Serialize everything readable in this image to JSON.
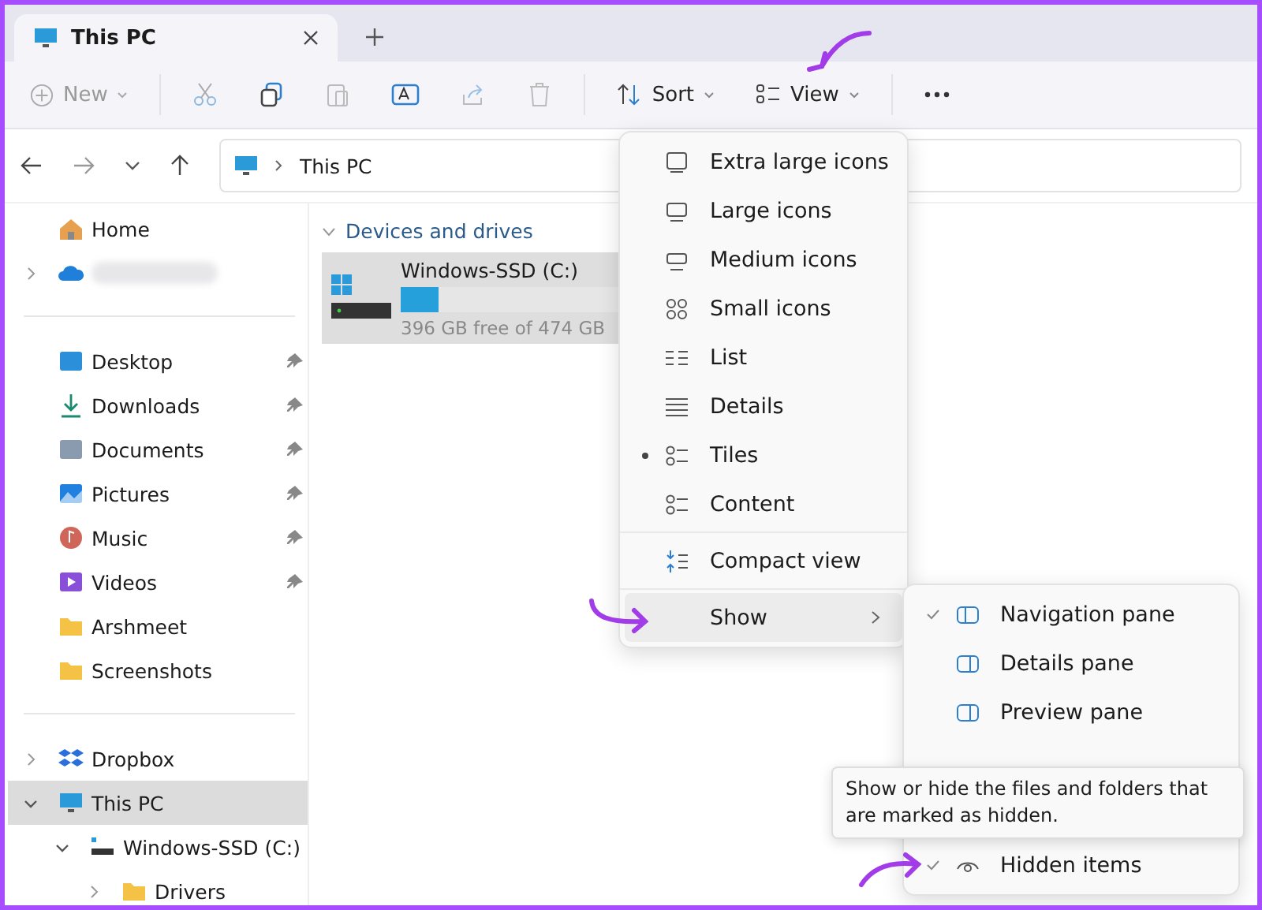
{
  "tab": {
    "title": "This PC",
    "selected": true
  },
  "toolbar": {
    "new": "New",
    "sort": "Sort",
    "view": "View"
  },
  "address": {
    "path": "This PC"
  },
  "sidebar": {
    "items": [
      {
        "kind": "home",
        "label": "Home"
      },
      {
        "kind": "cloud",
        "expanded": false
      },
      {
        "kind": "divider"
      },
      {
        "kind": "desktop",
        "label": "Desktop",
        "pinned": true
      },
      {
        "kind": "downloads",
        "label": "Downloads",
        "pinned": true
      },
      {
        "kind": "documents",
        "label": "Documents",
        "pinned": true
      },
      {
        "kind": "pictures",
        "label": "Pictures",
        "pinned": true
      },
      {
        "kind": "music",
        "label": "Music",
        "pinned": true
      },
      {
        "kind": "videos",
        "label": "Videos",
        "pinned": true
      },
      {
        "kind": "folder",
        "label": "Arshmeet",
        "pinned": false
      },
      {
        "kind": "folder",
        "label": "Screenshots",
        "pinned": false
      },
      {
        "kind": "divider"
      },
      {
        "kind": "dropbox",
        "label": "Dropbox",
        "expanded": false,
        "selected": false
      },
      {
        "kind": "pc",
        "label": "This PC",
        "expanded": true,
        "selected": true,
        "children": [
          {
            "kind": "drive",
            "label": "Windows-SSD (C:)",
            "expanded": true,
            "selected": false,
            "children": [
              {
                "kind": "folder",
                "label": "Drivers",
                "expanded": false,
                "selected": false
              }
            ]
          }
        ]
      }
    ]
  },
  "content": {
    "group": "Devices and drives",
    "drive": {
      "name": "Windows-SSD (C:)",
      "free": "396 GB free of 474 GB",
      "level": 0.17,
      "selected": true
    }
  },
  "view_menu": {
    "items": [
      {
        "label": "Extra large icons",
        "selected": false
      },
      {
        "label": "Large icons",
        "selected": false
      },
      {
        "label": "Medium icons",
        "selected": false
      },
      {
        "label": "Small icons",
        "selected": false
      },
      {
        "label": "List",
        "selected": false
      },
      {
        "label": "Details",
        "selected": false
      },
      {
        "label": "Tiles",
        "selected": true
      },
      {
        "label": "Content",
        "selected": false
      },
      {
        "label": "Compact view",
        "selected": false
      },
      {
        "label": "Show",
        "selected": false,
        "submenu": true
      }
    ]
  },
  "show_menu": {
    "items": [
      {
        "label": "Navigation pane",
        "checked": true
      },
      {
        "label": "Details pane",
        "checked": false
      },
      {
        "label": "Preview pane",
        "checked": false
      },
      {
        "label": "Hidden items",
        "checked": true
      }
    ]
  },
  "tooltip": {
    "text": "Show or hide the files and folders that are marked as hidden."
  }
}
